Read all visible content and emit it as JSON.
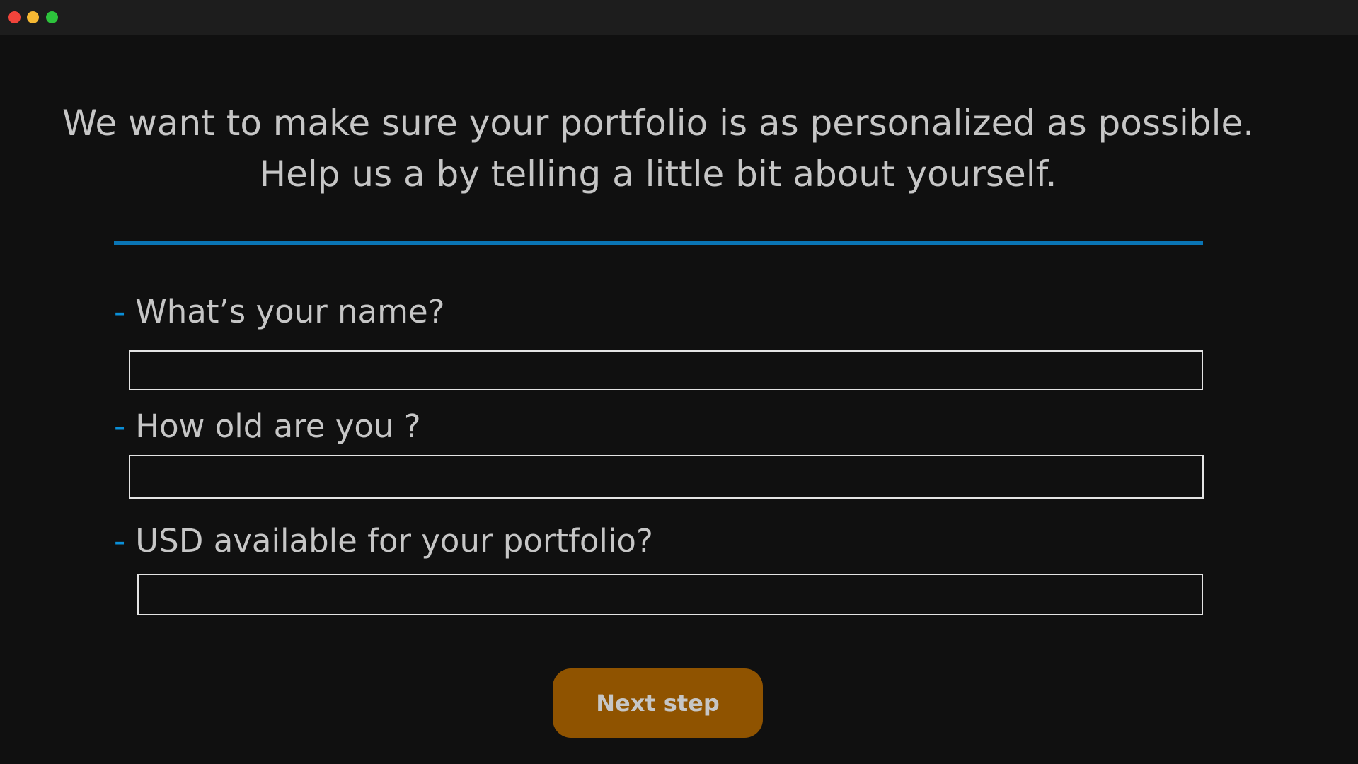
{
  "window": {
    "controls": [
      "close",
      "minimize",
      "maximize"
    ]
  },
  "intro": {
    "line1": "We want to make sure your portfolio is as personalized as possible.",
    "line2": "Help us a by telling a little bit about yourself."
  },
  "form": {
    "dash": "-",
    "name": {
      "label": "What’s your name?",
      "value": "",
      "placeholder": ""
    },
    "age": {
      "label": "How old are you ?",
      "value": "",
      "placeholder": ""
    },
    "usd": {
      "label": "USD available for your portfolio?",
      "value": "",
      "placeholder": ""
    }
  },
  "actions": {
    "next_label": "Next step"
  },
  "colors": {
    "background": "#101010",
    "text": "#c6c6c6",
    "accent_blue": "#0a75b5",
    "button": "#8f5300"
  }
}
